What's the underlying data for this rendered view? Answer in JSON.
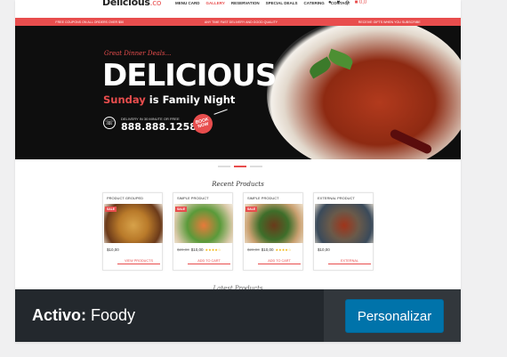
{
  "site": {
    "logo_text": "Delicious",
    "logo_suffix": ".co",
    "nav": [
      "MENU CARD",
      "GALLERY",
      "RESERVATION",
      "SPECIAL DEALS",
      "CATERING",
      "CONTACT"
    ],
    "nav_active_index": 1,
    "cart_count": "0,0",
    "topbar": [
      "FREE COUPONS ON ALL ORDERS OVER $50",
      "ANY TIME FAST DELIVERY AND GOOD QUALITY",
      "RECEIVE GIFTS WHEN YOU SUBSCRIBE"
    ]
  },
  "hero": {
    "tagline": "Great Dinner Deals...",
    "title": "DELICIOUS",
    "sub_red": "Sunday",
    "sub_rest": " is Family Night",
    "deliver_text": "DELIVERY IN 30 MINUTE OR FREE",
    "phone": "888.888.1258",
    "badge": "BOOK NOW"
  },
  "section": {
    "title": "Recent Products",
    "next_title": "Latest Products"
  },
  "products": [
    {
      "category": "PRODUCT GROUPED",
      "sale": "SALE",
      "old_price": "",
      "price": "$10,00",
      "stars": "",
      "button": "VIEW PRODUCTS"
    },
    {
      "category": "SIMPLE PRODUCT",
      "sale": "SALE",
      "old_price": "$20,00",
      "price": "$10,00",
      "stars": "★★★★☆",
      "button": "ADD TO CART"
    },
    {
      "category": "SIMPLE PRODUCT",
      "sale": "SALE",
      "old_price": "$20,00",
      "price": "$10,00",
      "stars": "★★★★☆",
      "button": "ADD TO CART"
    },
    {
      "category": "EXTERNAL PRODUCT",
      "sale": "",
      "old_price": "",
      "price": "$10,00",
      "stars": "",
      "button": "EXTERNAL"
    }
  ],
  "footer": {
    "active_label": "Activo:",
    "theme_name": "Foody",
    "customize_label": "Personalizar"
  },
  "colors": {
    "accent": "#e84d4d",
    "footer_bg": "#23282d",
    "button_bg": "#0073aa"
  }
}
